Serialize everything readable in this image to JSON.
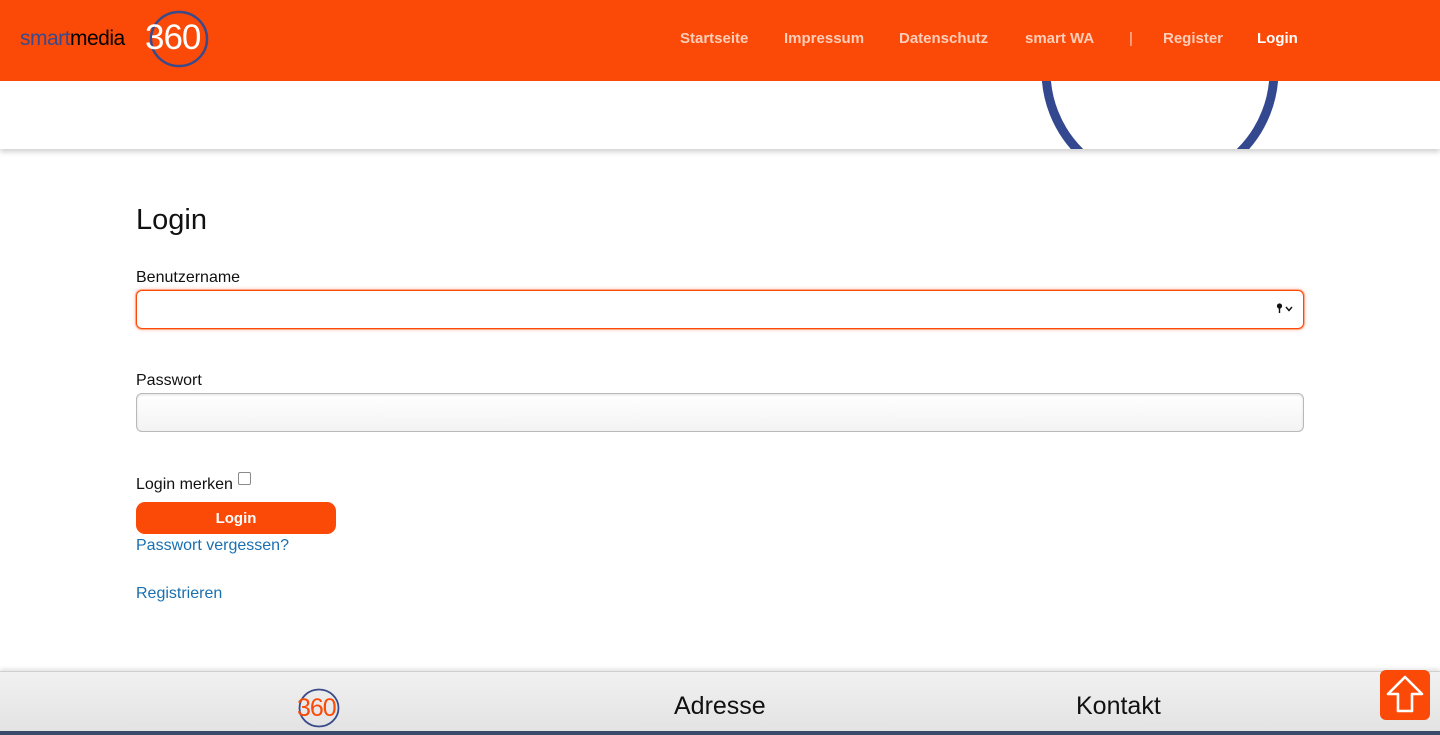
{
  "header": {
    "logo": {
      "smart": "smart",
      "media": "media",
      "number": "360"
    },
    "nav": [
      {
        "label": "Startseite"
      },
      {
        "label": "Impressum"
      },
      {
        "label": "Datenschutz"
      },
      {
        "label": "smart WA"
      },
      {
        "label": "|"
      },
      {
        "label": "Register"
      },
      {
        "label": "Login",
        "active": true
      }
    ],
    "accent_color": "#fb4a08",
    "brand_blue": "#3a4a8a"
  },
  "main": {
    "title": "Login",
    "username": {
      "label": "Benutzername",
      "value": "",
      "focused": true
    },
    "password": {
      "label": "Passwort",
      "value": ""
    },
    "remember": {
      "label": "Login merken",
      "checked": false
    },
    "submit_label": "Login",
    "forgot_link": "Passwort vergessen?",
    "register_link": "Registrieren"
  },
  "footer": {
    "logo_number": "360",
    "address_heading": "Adresse",
    "contact_heading": "Kontakt"
  },
  "icons": {
    "scroll_top": "arrow-up-icon",
    "password_manager": "key-icon"
  }
}
